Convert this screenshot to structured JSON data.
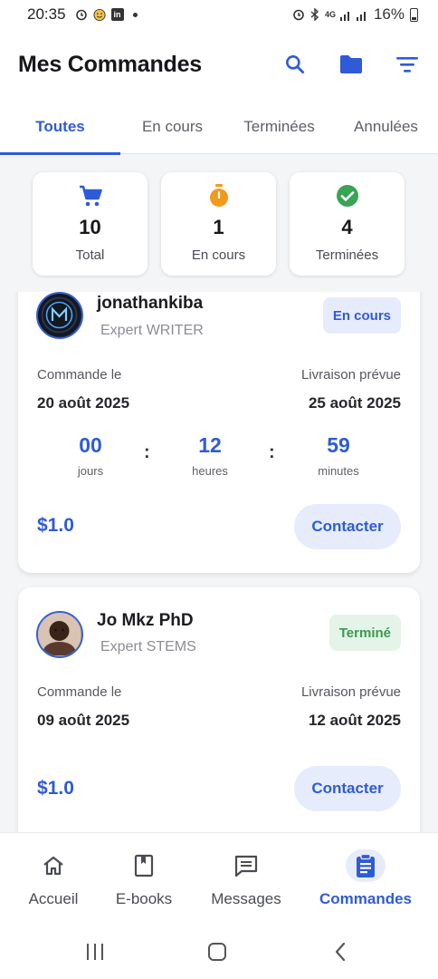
{
  "status_bar": {
    "time": "20:35",
    "battery": "16%",
    "network": "4G"
  },
  "header": {
    "title": "Mes Commandes",
    "icons": [
      "search-icon",
      "folder-icon",
      "filter-icon"
    ]
  },
  "tabs": [
    {
      "label": "Toutes",
      "active": true
    },
    {
      "label": "En cours",
      "active": false
    },
    {
      "label": "Terminées",
      "active": false
    },
    {
      "label": "Annulées",
      "active": false
    }
  ],
  "stats": [
    {
      "value": "10",
      "label": "Total",
      "icon": "cart-icon",
      "color": "#2f5bd8"
    },
    {
      "value": "1",
      "label": "En cours",
      "icon": "timer-icon",
      "color": "#f29a1b"
    },
    {
      "value": "4",
      "label": "Terminées",
      "icon": "check-circle-icon",
      "color": "#3aa356"
    }
  ],
  "orders": [
    {
      "name": "jonathankiba",
      "role": "Expert WRITER",
      "status": "En cours",
      "order_label": "Commande le",
      "order_date": "20 août 2025",
      "delivery_label": "Livraison prévue",
      "delivery_date": "25 août 2025",
      "countdown": {
        "days": "00",
        "days_label": "jours",
        "hours": "12",
        "hours_label": "heures",
        "minutes": "59",
        "minutes_label": "minutes",
        "separator": ":"
      },
      "price": "$1.0",
      "contact_label": "Contacter"
    },
    {
      "name": "Jo Mkz PhD",
      "role": "Expert STEMS",
      "status": "Terminé",
      "order_label": "Commande le",
      "order_date": "09 août 2025",
      "delivery_label": "Livraison prévue",
      "delivery_date": "12 août 2025",
      "price": "$1.0",
      "contact_label": "Contacter"
    }
  ],
  "bottom_nav": [
    {
      "label": "Accueil",
      "icon": "home-icon",
      "active": false
    },
    {
      "label": "E-books",
      "icon": "book-icon",
      "active": false
    },
    {
      "label": "Messages",
      "icon": "message-icon",
      "active": false
    },
    {
      "label": "Commandes",
      "icon": "orders-icon",
      "active": true
    }
  ],
  "colors": {
    "accent": "#2f5bd8",
    "accent_light": "#e6ecfb",
    "success": "#3a9a4d",
    "success_light": "#e5f4e8",
    "warning": "#f29a1b"
  }
}
